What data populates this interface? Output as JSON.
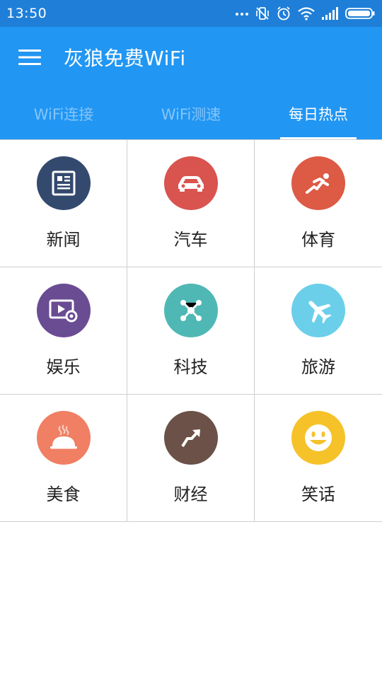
{
  "status_bar": {
    "time": "13:50",
    "icons": [
      "dots-icon",
      "vibrate-off-icon",
      "alarm-icon",
      "wifi-icon",
      "signal-icon",
      "battery-icon"
    ]
  },
  "app_bar": {
    "title": "灰狼免费WiFi",
    "menu_icon": "hamburger-icon"
  },
  "tabs": [
    {
      "label": "WiFi连接",
      "active": false
    },
    {
      "label": "WiFi测速",
      "active": false
    },
    {
      "label": "每日热点",
      "active": true
    }
  ],
  "categories": [
    {
      "label": "新闻",
      "icon": "newspaper-icon",
      "color": "#34496e"
    },
    {
      "label": "汽车",
      "icon": "car-icon",
      "color": "#d9534f"
    },
    {
      "label": "体育",
      "icon": "runner-icon",
      "color": "#dd5a45"
    },
    {
      "label": "娱乐",
      "icon": "video-icon",
      "color": "#6a4c93"
    },
    {
      "label": "科技",
      "icon": "molecule-icon",
      "color": "#4fb8b5"
    },
    {
      "label": "旅游",
      "icon": "airplane-icon",
      "color": "#6ccfea"
    },
    {
      "label": "美食",
      "icon": "food-cloche-icon",
      "color": "#f07f63"
    },
    {
      "label": "财经",
      "icon": "trend-arrow-icon",
      "color": "#6b5148"
    },
    {
      "label": "笑话",
      "icon": "smiley-icon",
      "color": "#f6c22a"
    }
  ],
  "colors": {
    "status_bar": "#1f7fd8",
    "app_bar": "#2196f3",
    "grid_line": "#cfcfcf"
  }
}
